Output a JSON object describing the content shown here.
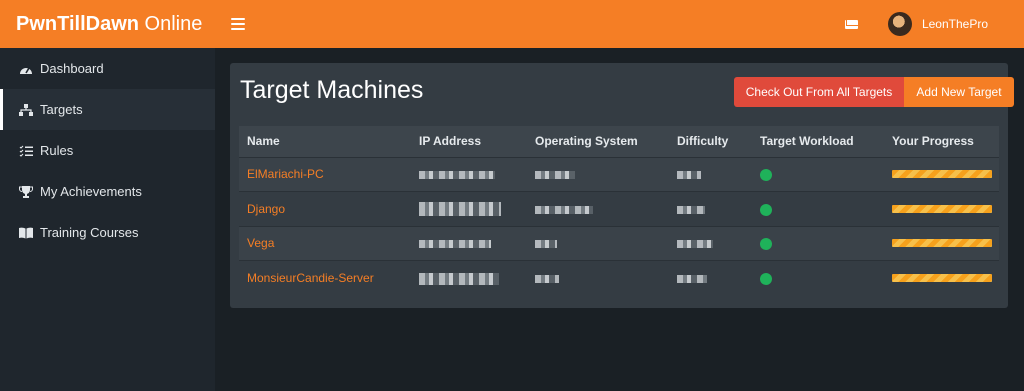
{
  "brand": {
    "bold": "PwnTillDawn",
    "light": " Online"
  },
  "header": {
    "username": "LeonThePro"
  },
  "sidebar": {
    "items": [
      {
        "label": "Dashboard",
        "icon": "dashboard-icon"
      },
      {
        "label": "Targets",
        "icon": "network-icon",
        "active": true
      },
      {
        "label": "Rules",
        "icon": "list-icon"
      },
      {
        "label": "My Achievements",
        "icon": "trophy-icon"
      },
      {
        "label": "Training Courses",
        "icon": "book-icon"
      }
    ]
  },
  "main": {
    "title": "Target Machines",
    "buttons": {
      "checkout": "Check Out From All Targets",
      "add": "Add New Target"
    },
    "table": {
      "headers": [
        "Name",
        "IP Address",
        "Operating System",
        "Difficulty",
        "Target Workload",
        "Your Progress"
      ],
      "rows": [
        {
          "name": "ElMariachi-PC",
          "workload_color": "#1fb25a",
          "progress": 1.0
        },
        {
          "name": "Django",
          "workload_color": "#1fb25a",
          "progress": 1.0
        },
        {
          "name": "Vega",
          "workload_color": "#1fb25a",
          "progress": 1.0
        },
        {
          "name": "MonsieurCandie-Server",
          "workload_color": "#1fb25a",
          "progress": 1.0
        }
      ]
    }
  },
  "colors": {
    "accent": "#f57e25",
    "danger": "#e04a3b",
    "success": "#1fb25a"
  }
}
